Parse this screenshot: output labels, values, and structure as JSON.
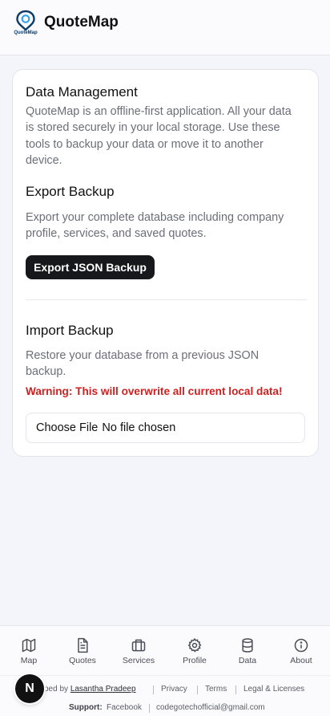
{
  "header": {
    "app_name": "QuoteMap",
    "logo_text": "QuoteMap"
  },
  "data_card": {
    "title": "Data Management",
    "intro": "QuoteMap is an offline-first application. All your data is stored securely in your local storage. Use these tools to backup your data or move it to another device.",
    "export": {
      "title": "Export Backup",
      "description": "Export your complete database including company profile, services, and saved quotes.",
      "button_label": "Export JSON Backup"
    },
    "import": {
      "title": "Import Backup",
      "description": "Restore your database from a previous JSON backup.",
      "warning": "Warning: This will overwrite all current local data!",
      "file_button": "Choose File",
      "file_status": "No file chosen"
    }
  },
  "bottom_nav": {
    "items": [
      {
        "label": "Map",
        "icon": "map-icon"
      },
      {
        "label": "Quotes",
        "icon": "document-icon"
      },
      {
        "label": "Services",
        "icon": "briefcase-icon"
      },
      {
        "label": "Profile",
        "icon": "gear-icon"
      },
      {
        "label": "Data",
        "icon": "database-icon"
      },
      {
        "label": "About",
        "icon": "info-icon"
      }
    ]
  },
  "footer": {
    "developed_prefix": "ped by",
    "developer": "Lasantha Pradeep",
    "privacy": "Privacy",
    "terms": "Terms",
    "legal": "Legal & Licenses",
    "support_label": "Support:",
    "facebook": "Facebook",
    "email": "codegotechofficial@gmail.com"
  },
  "dev_badge": {
    "letter": "N"
  },
  "colors": {
    "primary": "#17181c",
    "warning": "#d21f1f",
    "muted_text": "#6b6f78"
  }
}
